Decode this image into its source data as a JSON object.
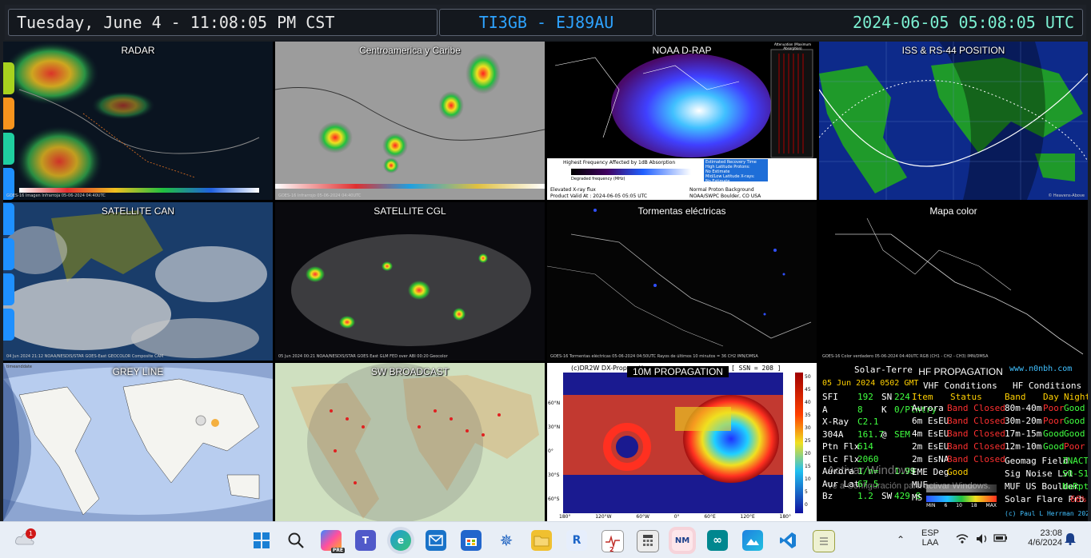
{
  "header": {
    "local_time": "Tuesday, June 4 - 11:08:05 PM CST",
    "station": "TI3GB - EJ89AU",
    "utc_time": "2024-06-05 05:08:05 UTC"
  },
  "panels": [
    {
      "title": "RADAR",
      "caption": "GOES-16 Imagen Infrarroja 05-06-2024 04:40UTC",
      "scale": [
        "-70",
        "-90",
        "30",
        "15"
      ],
      "unit": "°C"
    },
    {
      "title": "Centroamerica y Caribe",
      "caption": "GOES-16 Infrarrojo 05-06-2024 04:40UTC",
      "scale": [
        "90",
        "-70",
        "-50",
        "15",
        "30"
      ],
      "unit": "°C"
    },
    {
      "title": "NOAA D-RAP",
      "legend_title": "Highest Frequency Affected by 1dB Absorption",
      "legend_axis": "Degraded frequency (MHz)",
      "legend_ticks": [
        "0",
        "5",
        "10",
        "15",
        "20",
        "25",
        "30",
        "35"
      ],
      "att_label": "Attenuation (Maximum Absorption)",
      "recovery": [
        "Estimated Recovery Time",
        "High Latitude Protons:",
        "No Estimate",
        "Mid/Low Latitude X-rays:",
        "No Estimate"
      ],
      "flux": "Elevated X-ray flux",
      "valid": "Product Valid At : 2024-06-05 05:05 UTC",
      "background": "Normal Proton Background",
      "source": "NOAA/SWPC Boulder, CO USA"
    },
    {
      "title": "ISS & RS-44 POSITION",
      "caption": "© Heavens-Above"
    },
    {
      "title": "SATELLITE CAN",
      "caption": "04 Jun 2024 21:12   NOAA/NESDIS/STAR   GOES-East   GEOCOLOR Composite   CAM"
    },
    {
      "title": "SATELLITE CGL",
      "caption": "05 Jun 2024 00:21   NOAA/NESDIS/STAR   GOES East GLM FED over ABI 00:20 Geocolor"
    },
    {
      "title": "Tormentas eléctricas",
      "caption": "GOES-16 Tormentas eléctricas 05-06-2024 04:50UTC   Rayos de últimos 10 minutos = 36   CH2   IMN/DMSA"
    },
    {
      "title": "Mapa color",
      "caption": "GOES-16 Color verdadero 05-06-2024 04:40UTC   RGB (CH1 - CH2 - CH3)   IMN/DMSA"
    },
    {
      "title": "GREY LINE",
      "caption": "timeanddate"
    },
    {
      "title": "SW BROADCAST",
      "caption": ""
    },
    {
      "title": "10M PROPAGATION",
      "credit": "(c)DR2W DX-Propagation",
      "ssn": "[ SSN = 208 ]",
      "lat_ticks": [
        "60°N",
        "30°N",
        "0°",
        "30°S",
        "60°S"
      ],
      "lon_ticks": [
        "180°",
        "120°W",
        "60°W",
        "0°",
        "60°E",
        "120°E",
        "180°"
      ],
      "scale_ticks": [
        "50",
        "45",
        "40",
        "35",
        "30",
        "25",
        "20",
        "15",
        "10",
        "5",
        "0"
      ]
    },
    {
      "title": "HF PROPAGATION",
      "site": "www.n0nbh.com",
      "header_left": "Solar-Terrestrial",
      "date": "05 Jun 2024 0502 GMT",
      "left_rows": [
        {
          "k": "SFI",
          "v": "192",
          "k2": "SN",
          "v2": "224"
        },
        {
          "k": "A",
          "v": "8",
          "k2": "K",
          "v2": "0/Plntry"
        },
        {
          "k": "X-Ray",
          "v": "C2.1",
          "k2": "",
          "v2": ""
        },
        {
          "k": "304A",
          "v": "161.7",
          "k2": "@",
          "v2": "SEM"
        },
        {
          "k": "Ptn Flx",
          "v": "614",
          "k2": "",
          "v2": ""
        },
        {
          "k": "Elc Flx",
          "v": "2060",
          "k2": "",
          "v2": ""
        },
        {
          "k": "Aurora",
          "v": "1/n=",
          "k2": "",
          "v2": "1.99"
        },
        {
          "k": "Aur Lat",
          "v": "67.5",
          "k2": "",
          "v2": ""
        },
        {
          "k": "Bz",
          "v": "1.2",
          "k2": "SW",
          "v2": "429.8"
        }
      ],
      "vhf_title": "VHF Conditions",
      "vhf_head": [
        "Item",
        "Status"
      ],
      "vhf_rows": [
        {
          "item": "Aurora",
          "status": "Band Closed"
        },
        {
          "item": "6m EsEU",
          "status": "Band Closed"
        },
        {
          "item": "4m EsEU",
          "status": "Band Closed"
        },
        {
          "item": "2m EsEU",
          "status": "Band Closed"
        },
        {
          "item": "2m EsNA",
          "status": "Band Closed"
        },
        {
          "item": "EME Deg",
          "status": "Good"
        },
        {
          "item": "MUF",
          "status": ""
        },
        {
          "item": "MS",
          "status": ""
        }
      ],
      "hf_title": "HF Conditions",
      "hf_head": [
        "Band",
        "Day",
        "Night"
      ],
      "hf_rows": [
        {
          "band": "80m-40m",
          "day": "Poor",
          "night": "Good"
        },
        {
          "band": "30m-20m",
          "day": "Poor",
          "night": "Good"
        },
        {
          "band": "17m-15m",
          "day": "Good",
          "night": "Good"
        },
        {
          "band": "12m-10m",
          "day": "Good",
          "night": "Poor"
        }
      ],
      "extra": [
        {
          "k": "Geomag Field",
          "v": "INACTIVE"
        },
        {
          "k": "Sig Noise Lvl",
          "v": "S0-S1"
        },
        {
          "k": "MUF US Boulder",
          "v": "NoRpt"
        },
        {
          "k": "Solar Flare Prb",
          "v": "66%"
        }
      ],
      "copyright": "(c) Paul L Herrman 2024",
      "muf_scale": [
        "MIN",
        "MUF",
        "6",
        "10",
        "18",
        "MAX"
      ]
    }
  ],
  "overlay": {
    "line1": "Activar Windows",
    "line2": "Ve a Configuración para activar Windows."
  },
  "side_tab_colors": [
    "#a8d21e",
    "#f7941d",
    "#1fcfa0",
    "#1e90ff",
    "#1e90ff",
    "#1e90ff",
    "#1e90ff",
    "#1e90ff"
  ],
  "taskbar": {
    "weather_badge": "1",
    "apps": [
      "windows-icon",
      "search-icon",
      "copilot-icon",
      "teams-icon",
      "edge-icon",
      "mail-icon",
      "store-icon",
      "compass-icon",
      "files-icon",
      "remote-icon",
      "heart-monitor-icon",
      "calculator-icon",
      "nmi-icon",
      "arduino-icon",
      "photos-icon",
      "vscode-icon",
      "notepad-icon"
    ],
    "pre_label": "PRE",
    "calc_label": "2",
    "nm_label": "NM",
    "lang": "ESP",
    "lang_sub": "LAA",
    "time": "23:08",
    "date": "4/6/2024"
  }
}
